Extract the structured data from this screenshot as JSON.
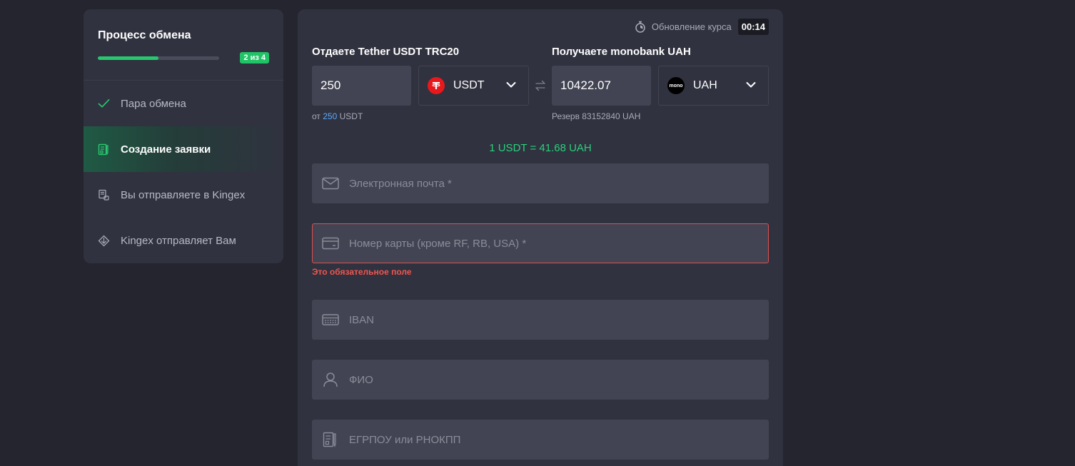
{
  "sidebar": {
    "title": "Процесс обмена",
    "progress": {
      "current": 2,
      "total": 4,
      "fraction": 0.5,
      "badge": "2 из 4"
    },
    "items": [
      {
        "label": "Пара обмена",
        "icon": "check-icon",
        "state": "done"
      },
      {
        "label": "Создание заявки",
        "icon": "form-doc-icon",
        "state": "active"
      },
      {
        "label": "Вы отправляете в Kingex",
        "icon": "send-doc-icon",
        "state": "pending"
      },
      {
        "label": "Kingex отправляет Вам",
        "icon": "receive-icon",
        "state": "pending"
      }
    ]
  },
  "header": {
    "rate_update_label": "Обновление курса",
    "timer": "00:14"
  },
  "give": {
    "label": "Отдаете Tether USDT TRC20",
    "amount": "250",
    "currency": "USDT",
    "note_prefix": "от",
    "note_value": "250",
    "note_suffix": "USDT"
  },
  "receive": {
    "label": "Получаете monobank UAH",
    "amount": "10422.07",
    "currency": "UAH",
    "coin_text": "mono",
    "note": "Резерв 83152840 UAH"
  },
  "rate": "1 USDT = 41.68 UAH",
  "fields": {
    "email": {
      "placeholder": "Электронная почта *"
    },
    "card": {
      "placeholder": "Номер карты (кроме RF, RB, USA) *",
      "error": "Это обязательное поле"
    },
    "iban": {
      "placeholder": "IBAN"
    },
    "name": {
      "placeholder": "ФИО"
    },
    "tax": {
      "placeholder": "ЕГРПОУ или РНОКПП"
    }
  },
  "colors": {
    "accent": "#28c76f",
    "error": "#f1554f",
    "tether": "#e8191d",
    "link": "#5aa9ff"
  }
}
